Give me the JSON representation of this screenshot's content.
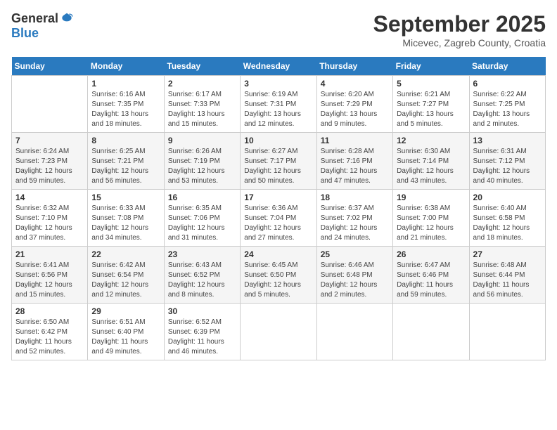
{
  "logo": {
    "general": "General",
    "blue": "Blue"
  },
  "title": "September 2025",
  "location": "Micevec, Zagreb County, Croatia",
  "weekdays": [
    "Sunday",
    "Monday",
    "Tuesday",
    "Wednesday",
    "Thursday",
    "Friday",
    "Saturday"
  ],
  "weeks": [
    [
      {
        "day": "",
        "content": ""
      },
      {
        "day": "1",
        "content": "Sunrise: 6:16 AM\nSunset: 7:35 PM\nDaylight: 13 hours\nand 18 minutes."
      },
      {
        "day": "2",
        "content": "Sunrise: 6:17 AM\nSunset: 7:33 PM\nDaylight: 13 hours\nand 15 minutes."
      },
      {
        "day": "3",
        "content": "Sunrise: 6:19 AM\nSunset: 7:31 PM\nDaylight: 13 hours\nand 12 minutes."
      },
      {
        "day": "4",
        "content": "Sunrise: 6:20 AM\nSunset: 7:29 PM\nDaylight: 13 hours\nand 9 minutes."
      },
      {
        "day": "5",
        "content": "Sunrise: 6:21 AM\nSunset: 7:27 PM\nDaylight: 13 hours\nand 5 minutes."
      },
      {
        "day": "6",
        "content": "Sunrise: 6:22 AM\nSunset: 7:25 PM\nDaylight: 13 hours\nand 2 minutes."
      }
    ],
    [
      {
        "day": "7",
        "content": "Sunrise: 6:24 AM\nSunset: 7:23 PM\nDaylight: 12 hours\nand 59 minutes."
      },
      {
        "day": "8",
        "content": "Sunrise: 6:25 AM\nSunset: 7:21 PM\nDaylight: 12 hours\nand 56 minutes."
      },
      {
        "day": "9",
        "content": "Sunrise: 6:26 AM\nSunset: 7:19 PM\nDaylight: 12 hours\nand 53 minutes."
      },
      {
        "day": "10",
        "content": "Sunrise: 6:27 AM\nSunset: 7:17 PM\nDaylight: 12 hours\nand 50 minutes."
      },
      {
        "day": "11",
        "content": "Sunrise: 6:28 AM\nSunset: 7:16 PM\nDaylight: 12 hours\nand 47 minutes."
      },
      {
        "day": "12",
        "content": "Sunrise: 6:30 AM\nSunset: 7:14 PM\nDaylight: 12 hours\nand 43 minutes."
      },
      {
        "day": "13",
        "content": "Sunrise: 6:31 AM\nSunset: 7:12 PM\nDaylight: 12 hours\nand 40 minutes."
      }
    ],
    [
      {
        "day": "14",
        "content": "Sunrise: 6:32 AM\nSunset: 7:10 PM\nDaylight: 12 hours\nand 37 minutes."
      },
      {
        "day": "15",
        "content": "Sunrise: 6:33 AM\nSunset: 7:08 PM\nDaylight: 12 hours\nand 34 minutes."
      },
      {
        "day": "16",
        "content": "Sunrise: 6:35 AM\nSunset: 7:06 PM\nDaylight: 12 hours\nand 31 minutes."
      },
      {
        "day": "17",
        "content": "Sunrise: 6:36 AM\nSunset: 7:04 PM\nDaylight: 12 hours\nand 27 minutes."
      },
      {
        "day": "18",
        "content": "Sunrise: 6:37 AM\nSunset: 7:02 PM\nDaylight: 12 hours\nand 24 minutes."
      },
      {
        "day": "19",
        "content": "Sunrise: 6:38 AM\nSunset: 7:00 PM\nDaylight: 12 hours\nand 21 minutes."
      },
      {
        "day": "20",
        "content": "Sunrise: 6:40 AM\nSunset: 6:58 PM\nDaylight: 12 hours\nand 18 minutes."
      }
    ],
    [
      {
        "day": "21",
        "content": "Sunrise: 6:41 AM\nSunset: 6:56 PM\nDaylight: 12 hours\nand 15 minutes."
      },
      {
        "day": "22",
        "content": "Sunrise: 6:42 AM\nSunset: 6:54 PM\nDaylight: 12 hours\nand 12 minutes."
      },
      {
        "day": "23",
        "content": "Sunrise: 6:43 AM\nSunset: 6:52 PM\nDaylight: 12 hours\nand 8 minutes."
      },
      {
        "day": "24",
        "content": "Sunrise: 6:45 AM\nSunset: 6:50 PM\nDaylight: 12 hours\nand 5 minutes."
      },
      {
        "day": "25",
        "content": "Sunrise: 6:46 AM\nSunset: 6:48 PM\nDaylight: 12 hours\nand 2 minutes."
      },
      {
        "day": "26",
        "content": "Sunrise: 6:47 AM\nSunset: 6:46 PM\nDaylight: 11 hours\nand 59 minutes."
      },
      {
        "day": "27",
        "content": "Sunrise: 6:48 AM\nSunset: 6:44 PM\nDaylight: 11 hours\nand 56 minutes."
      }
    ],
    [
      {
        "day": "28",
        "content": "Sunrise: 6:50 AM\nSunset: 6:42 PM\nDaylight: 11 hours\nand 52 minutes."
      },
      {
        "day": "29",
        "content": "Sunrise: 6:51 AM\nSunset: 6:40 PM\nDaylight: 11 hours\nand 49 minutes."
      },
      {
        "day": "30",
        "content": "Sunrise: 6:52 AM\nSunset: 6:39 PM\nDaylight: 11 hours\nand 46 minutes."
      },
      {
        "day": "",
        "content": ""
      },
      {
        "day": "",
        "content": ""
      },
      {
        "day": "",
        "content": ""
      },
      {
        "day": "",
        "content": ""
      }
    ]
  ]
}
